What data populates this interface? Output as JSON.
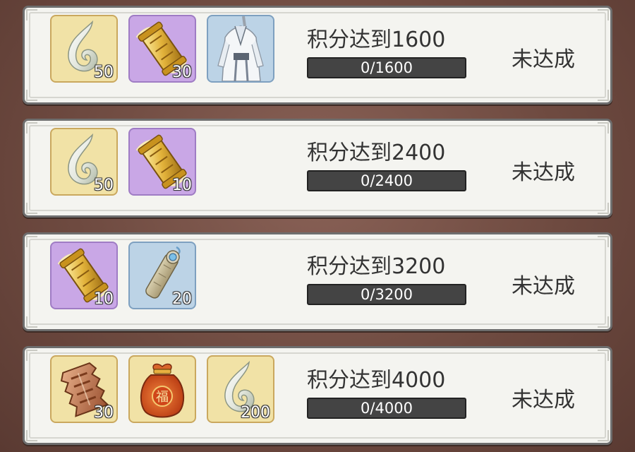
{
  "tiers": [
    {
      "goal": "积分达到1600",
      "progress_text": "0/1600",
      "progress_fraction": 0,
      "status": "未达成",
      "rewards": [
        {
          "icon": "jade-hook-icon",
          "quality": "yellow",
          "qty": "50"
        },
        {
          "icon": "golden-scroll-icon",
          "quality": "purple",
          "qty": "30"
        },
        {
          "icon": "white-robe-costume-icon",
          "quality": "blue",
          "qty": ""
        }
      ]
    },
    {
      "goal": "积分达到2400",
      "progress_text": "0/2400",
      "progress_fraction": 0,
      "status": "未达成",
      "rewards": [
        {
          "icon": "jade-hook-icon",
          "quality": "yellow",
          "qty": "50"
        },
        {
          "icon": "golden-scroll-icon",
          "quality": "purple",
          "qty": "10"
        }
      ]
    },
    {
      "goal": "积分达到3200",
      "progress_text": "0/3200",
      "progress_fraction": 0,
      "status": "未达成",
      "rewards": [
        {
          "icon": "golden-scroll-icon",
          "quality": "purple",
          "qty": "10"
        },
        {
          "icon": "rolled-scroll-icon",
          "quality": "blue",
          "qty": "20"
        }
      ]
    },
    {
      "goal": "积分达到4000",
      "progress_text": "0/4000",
      "progress_fraction": 0,
      "status": "未达成",
      "rewards": [
        {
          "icon": "bronze-token-icon",
          "quality": "yellow",
          "qty": "30"
        },
        {
          "icon": "fortune-bag-icon",
          "quality": "yellow",
          "qty": ""
        },
        {
          "icon": "jade-hook-icon",
          "quality": "yellow",
          "qty": "200"
        }
      ]
    }
  ],
  "fortune_bag_character": "福",
  "colors": {
    "background": "#6e4a40",
    "card": "#f4f4f0",
    "progress_track": "#444444",
    "text": "#333333",
    "quality_yellow": "#f1e2a6",
    "quality_purple": "#c9a7e6",
    "quality_blue": "#bcd3e6"
  }
}
